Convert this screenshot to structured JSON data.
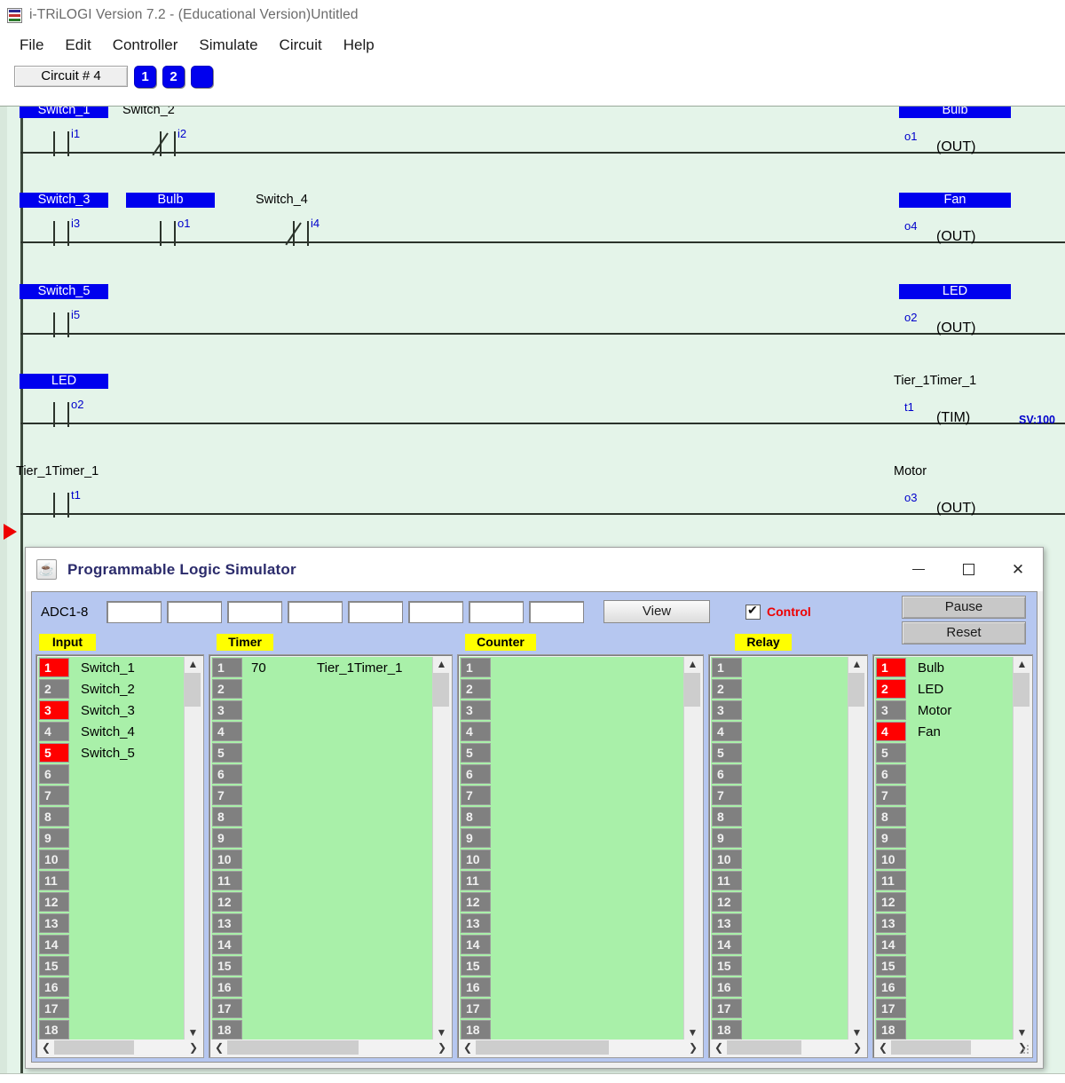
{
  "window": {
    "title": "i-TRiLOGI Version 7.2 - (Educational Version)Untitled",
    "icon": "trilogi-icon"
  },
  "menu": {
    "items": [
      "File",
      "Edit",
      "Controller",
      "Simulate",
      "Circuit",
      "Help"
    ]
  },
  "toolbar": {
    "circuit_label": "Circuit # 4",
    "pages": [
      "1",
      "2",
      ""
    ]
  },
  "ladder": {
    "rungs": [
      {
        "contacts": [
          {
            "name": "Switch_1",
            "addr": "i1",
            "type": "no",
            "highlight": true
          },
          {
            "name": "Switch_2",
            "addr": "i2",
            "type": "nc",
            "highlight": false
          }
        ],
        "output": {
          "name": "Bulb",
          "addr": "o1",
          "kind": "(OUT)",
          "highlight": true,
          "sv": ""
        }
      },
      {
        "contacts": [
          {
            "name": "Switch_3",
            "addr": "i3",
            "type": "no",
            "highlight": true
          },
          {
            "name": "Bulb",
            "addr": "o1",
            "type": "no",
            "highlight": true
          },
          {
            "name": "Switch_4",
            "addr": "i4",
            "type": "nc",
            "highlight": false
          }
        ],
        "output": {
          "name": "Fan",
          "addr": "o4",
          "kind": "(OUT)",
          "highlight": true,
          "sv": ""
        }
      },
      {
        "contacts": [
          {
            "name": "Switch_5",
            "addr": "i5",
            "type": "no",
            "highlight": true
          }
        ],
        "output": {
          "name": "LED",
          "addr": "o2",
          "kind": "(OUT)",
          "highlight": true,
          "sv": ""
        }
      },
      {
        "contacts": [
          {
            "name": "LED",
            "addr": "o2",
            "type": "no",
            "highlight": true
          }
        ],
        "output": {
          "name": "Tier_1Timer_1",
          "addr": "t1",
          "kind": "(TIM)",
          "highlight": false,
          "sv": "SV:100"
        }
      },
      {
        "contacts": [
          {
            "name": "Tier_1Timer_1",
            "addr": "t1",
            "type": "no",
            "highlight": false
          }
        ],
        "output": {
          "name": "Motor",
          "addr": "o3",
          "kind": "(OUT)",
          "highlight": false,
          "sv": ""
        }
      }
    ]
  },
  "simulator": {
    "title": "Programmable Logic Simulator",
    "window_buttons": {
      "minimize": "minimize-icon",
      "maximize": "maximize-icon",
      "close": "close-icon"
    },
    "adc": {
      "label": "ADC1-8",
      "fields": [
        "",
        "",
        "",
        "",
        "",
        "",
        "",
        ""
      ]
    },
    "view_button": "View",
    "control_checkbox": {
      "label": "Control",
      "checked": true
    },
    "pause_button": "Pause",
    "reset_button": "Reset",
    "sections": [
      {
        "tag": "Input"
      },
      {
        "tag": "Timer"
      },
      {
        "tag": "Counter"
      },
      {
        "tag": "Relay"
      },
      {
        "tag": ""
      }
    ],
    "panels": {
      "input": {
        "rows": [
          {
            "n": "1",
            "label": "Switch_1",
            "on": true
          },
          {
            "n": "2",
            "label": "Switch_2",
            "on": false
          },
          {
            "n": "3",
            "label": "Switch_3",
            "on": true
          },
          {
            "n": "4",
            "label": "Switch_4",
            "on": false
          },
          {
            "n": "5",
            "label": "Switch_5",
            "on": true
          },
          {
            "n": "6",
            "label": "",
            "on": false
          },
          {
            "n": "7",
            "label": "",
            "on": false
          },
          {
            "n": "8",
            "label": "",
            "on": false
          },
          {
            "n": "9",
            "label": "",
            "on": false
          },
          {
            "n": "10",
            "label": "",
            "on": false
          },
          {
            "n": "11",
            "label": "",
            "on": false
          },
          {
            "n": "12",
            "label": "",
            "on": false
          },
          {
            "n": "13",
            "label": "",
            "on": false
          },
          {
            "n": "14",
            "label": "",
            "on": false
          },
          {
            "n": "15",
            "label": "",
            "on": false
          },
          {
            "n": "16",
            "label": "",
            "on": false
          },
          {
            "n": "17",
            "label": "",
            "on": false
          },
          {
            "n": "18",
            "label": "",
            "on": false
          }
        ]
      },
      "timer": {
        "rows": [
          {
            "n": "1",
            "value": "70",
            "label": "Tier_1Timer_1",
            "on": false
          },
          {
            "n": "2",
            "value": "",
            "label": "",
            "on": false
          },
          {
            "n": "3",
            "value": "",
            "label": "",
            "on": false
          },
          {
            "n": "4",
            "value": "",
            "label": "",
            "on": false
          },
          {
            "n": "5",
            "value": "",
            "label": "",
            "on": false
          },
          {
            "n": "6",
            "value": "",
            "label": "",
            "on": false
          },
          {
            "n": "7",
            "value": "",
            "label": "",
            "on": false
          },
          {
            "n": "8",
            "value": "",
            "label": "",
            "on": false
          },
          {
            "n": "9",
            "value": "",
            "label": "",
            "on": false
          },
          {
            "n": "10",
            "value": "",
            "label": "",
            "on": false
          },
          {
            "n": "11",
            "value": "",
            "label": "",
            "on": false
          },
          {
            "n": "12",
            "value": "",
            "label": "",
            "on": false
          },
          {
            "n": "13",
            "value": "",
            "label": "",
            "on": false
          },
          {
            "n": "14",
            "value": "",
            "label": "",
            "on": false
          },
          {
            "n": "15",
            "value": "",
            "label": "",
            "on": false
          },
          {
            "n": "16",
            "value": "",
            "label": "",
            "on": false
          },
          {
            "n": "17",
            "value": "",
            "label": "",
            "on": false
          },
          {
            "n": "18",
            "value": "",
            "label": "",
            "on": false
          }
        ]
      },
      "counter": {
        "rows": [
          {
            "n": "1",
            "value": "",
            "label": "",
            "on": false
          },
          {
            "n": "2",
            "value": "",
            "label": "",
            "on": false
          },
          {
            "n": "3",
            "value": "",
            "label": "",
            "on": false
          },
          {
            "n": "4",
            "value": "",
            "label": "",
            "on": false
          },
          {
            "n": "5",
            "value": "",
            "label": "",
            "on": false
          },
          {
            "n": "6",
            "value": "",
            "label": "",
            "on": false
          },
          {
            "n": "7",
            "value": "",
            "label": "",
            "on": false
          },
          {
            "n": "8",
            "value": "",
            "label": "",
            "on": false
          },
          {
            "n": "9",
            "value": "",
            "label": "",
            "on": false
          },
          {
            "n": "10",
            "value": "",
            "label": "",
            "on": false
          },
          {
            "n": "11",
            "value": "",
            "label": "",
            "on": false
          },
          {
            "n": "12",
            "value": "",
            "label": "",
            "on": false
          },
          {
            "n": "13",
            "value": "",
            "label": "",
            "on": false
          },
          {
            "n": "14",
            "value": "",
            "label": "",
            "on": false
          },
          {
            "n": "15",
            "value": "",
            "label": "",
            "on": false
          },
          {
            "n": "16",
            "value": "",
            "label": "",
            "on": false
          },
          {
            "n": "17",
            "value": "",
            "label": "",
            "on": false
          },
          {
            "n": "18",
            "value": "",
            "label": "",
            "on": false
          }
        ]
      },
      "relay": {
        "rows": [
          {
            "n": "1",
            "label": "",
            "on": false
          },
          {
            "n": "2",
            "label": "",
            "on": false
          },
          {
            "n": "3",
            "label": "",
            "on": false
          },
          {
            "n": "4",
            "label": "",
            "on": false
          },
          {
            "n": "5",
            "label": "",
            "on": false
          },
          {
            "n": "6",
            "label": "",
            "on": false
          },
          {
            "n": "7",
            "label": "",
            "on": false
          },
          {
            "n": "8",
            "label": "",
            "on": false
          },
          {
            "n": "9",
            "label": "",
            "on": false
          },
          {
            "n": "10",
            "label": "",
            "on": false
          },
          {
            "n": "11",
            "label": "",
            "on": false
          },
          {
            "n": "12",
            "label": "",
            "on": false
          },
          {
            "n": "13",
            "label": "",
            "on": false
          },
          {
            "n": "14",
            "label": "",
            "on": false
          },
          {
            "n": "15",
            "label": "",
            "on": false
          },
          {
            "n": "16",
            "label": "",
            "on": false
          },
          {
            "n": "17",
            "label": "",
            "on": false
          },
          {
            "n": "18",
            "label": "",
            "on": false
          }
        ]
      },
      "output": {
        "rows": [
          {
            "n": "1",
            "label": "Bulb",
            "on": true
          },
          {
            "n": "2",
            "label": "LED",
            "on": true
          },
          {
            "n": "3",
            "label": "Motor",
            "on": false
          },
          {
            "n": "4",
            "label": "Fan",
            "on": true
          },
          {
            "n": "5",
            "label": "",
            "on": false
          },
          {
            "n": "6",
            "label": "",
            "on": false
          },
          {
            "n": "7",
            "label": "",
            "on": false
          },
          {
            "n": "8",
            "label": "",
            "on": false
          },
          {
            "n": "9",
            "label": "",
            "on": false
          },
          {
            "n": "10",
            "label": "",
            "on": false
          },
          {
            "n": "11",
            "label": "",
            "on": false
          },
          {
            "n": "12",
            "label": "",
            "on": false
          },
          {
            "n": "13",
            "label": "",
            "on": false
          },
          {
            "n": "14",
            "label": "",
            "on": false
          },
          {
            "n": "15",
            "label": "",
            "on": false
          },
          {
            "n": "16",
            "label": "",
            "on": false
          },
          {
            "n": "17",
            "label": "",
            "on": false
          },
          {
            "n": "18",
            "label": "",
            "on": false
          }
        ]
      }
    },
    "scroll_icons": {
      "up": "▲",
      "down": "▼",
      "left": "❮",
      "right": "❯"
    }
  },
  "colors": {
    "plate_blue": "#0000ee",
    "canvas_green": "#e4f4e9",
    "list_green": "#a9f0a9",
    "active_red": "#ff0000",
    "tag_yellow": "#ffff00",
    "panel_blue": "#b6c7f0"
  }
}
